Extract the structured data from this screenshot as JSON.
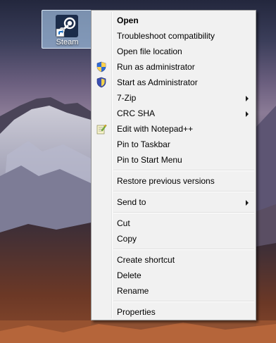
{
  "desktop": {
    "icon_label": "Steam"
  },
  "context_menu": {
    "groups": [
      [
        {
          "label": "Open",
          "bold": true
        },
        {
          "label": "Troubleshoot compatibility"
        },
        {
          "label": "Open file location"
        },
        {
          "label": "Run as administrator",
          "icon": "uac-shield-icon"
        },
        {
          "label": "Start as Administrator",
          "icon": "admin-shield-icon"
        },
        {
          "label": "7-Zip",
          "submenu": true
        },
        {
          "label": "CRC SHA",
          "submenu": true
        },
        {
          "label": "Edit with Notepad++",
          "icon": "notepad-plus-plus-icon"
        },
        {
          "label": "Pin to Taskbar"
        },
        {
          "label": "Pin to Start Menu"
        }
      ],
      [
        {
          "label": "Restore previous versions"
        }
      ],
      [
        {
          "label": "Send to",
          "submenu": true
        }
      ],
      [
        {
          "label": "Cut"
        },
        {
          "label": "Copy"
        }
      ],
      [
        {
          "label": "Create shortcut"
        },
        {
          "label": "Delete"
        },
        {
          "label": "Rename"
        }
      ],
      [
        {
          "label": "Properties"
        }
      ]
    ]
  },
  "colors": {
    "menu_background": "#f1f1f1",
    "menu_border": "#979797",
    "selection_tint": "#adcef0"
  }
}
